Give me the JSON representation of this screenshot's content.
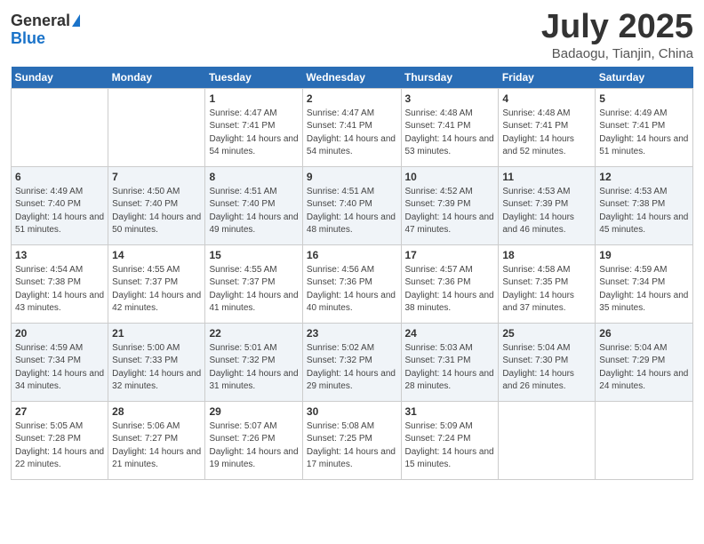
{
  "header": {
    "logo_general": "General",
    "logo_blue": "Blue",
    "month": "July 2025",
    "location": "Badaogu, Tianjin, China"
  },
  "days_of_week": [
    "Sunday",
    "Monday",
    "Tuesday",
    "Wednesday",
    "Thursday",
    "Friday",
    "Saturday"
  ],
  "weeks": [
    [
      {
        "day": "",
        "sunrise": "",
        "sunset": "",
        "daylight": ""
      },
      {
        "day": "",
        "sunrise": "",
        "sunset": "",
        "daylight": ""
      },
      {
        "day": "1",
        "sunrise": "Sunrise: 4:47 AM",
        "sunset": "Sunset: 7:41 PM",
        "daylight": "Daylight: 14 hours and 54 minutes."
      },
      {
        "day": "2",
        "sunrise": "Sunrise: 4:47 AM",
        "sunset": "Sunset: 7:41 PM",
        "daylight": "Daylight: 14 hours and 54 minutes."
      },
      {
        "day": "3",
        "sunrise": "Sunrise: 4:48 AM",
        "sunset": "Sunset: 7:41 PM",
        "daylight": "Daylight: 14 hours and 53 minutes."
      },
      {
        "day": "4",
        "sunrise": "Sunrise: 4:48 AM",
        "sunset": "Sunset: 7:41 PM",
        "daylight": "Daylight: 14 hours and 52 minutes."
      },
      {
        "day": "5",
        "sunrise": "Sunrise: 4:49 AM",
        "sunset": "Sunset: 7:41 PM",
        "daylight": "Daylight: 14 hours and 51 minutes."
      }
    ],
    [
      {
        "day": "6",
        "sunrise": "Sunrise: 4:49 AM",
        "sunset": "Sunset: 7:40 PM",
        "daylight": "Daylight: 14 hours and 51 minutes."
      },
      {
        "day": "7",
        "sunrise": "Sunrise: 4:50 AM",
        "sunset": "Sunset: 7:40 PM",
        "daylight": "Daylight: 14 hours and 50 minutes."
      },
      {
        "day": "8",
        "sunrise": "Sunrise: 4:51 AM",
        "sunset": "Sunset: 7:40 PM",
        "daylight": "Daylight: 14 hours and 49 minutes."
      },
      {
        "day": "9",
        "sunrise": "Sunrise: 4:51 AM",
        "sunset": "Sunset: 7:40 PM",
        "daylight": "Daylight: 14 hours and 48 minutes."
      },
      {
        "day": "10",
        "sunrise": "Sunrise: 4:52 AM",
        "sunset": "Sunset: 7:39 PM",
        "daylight": "Daylight: 14 hours and 47 minutes."
      },
      {
        "day": "11",
        "sunrise": "Sunrise: 4:53 AM",
        "sunset": "Sunset: 7:39 PM",
        "daylight": "Daylight: 14 hours and 46 minutes."
      },
      {
        "day": "12",
        "sunrise": "Sunrise: 4:53 AM",
        "sunset": "Sunset: 7:38 PM",
        "daylight": "Daylight: 14 hours and 45 minutes."
      }
    ],
    [
      {
        "day": "13",
        "sunrise": "Sunrise: 4:54 AM",
        "sunset": "Sunset: 7:38 PM",
        "daylight": "Daylight: 14 hours and 43 minutes."
      },
      {
        "day": "14",
        "sunrise": "Sunrise: 4:55 AM",
        "sunset": "Sunset: 7:37 PM",
        "daylight": "Daylight: 14 hours and 42 minutes."
      },
      {
        "day": "15",
        "sunrise": "Sunrise: 4:55 AM",
        "sunset": "Sunset: 7:37 PM",
        "daylight": "Daylight: 14 hours and 41 minutes."
      },
      {
        "day": "16",
        "sunrise": "Sunrise: 4:56 AM",
        "sunset": "Sunset: 7:36 PM",
        "daylight": "Daylight: 14 hours and 40 minutes."
      },
      {
        "day": "17",
        "sunrise": "Sunrise: 4:57 AM",
        "sunset": "Sunset: 7:36 PM",
        "daylight": "Daylight: 14 hours and 38 minutes."
      },
      {
        "day": "18",
        "sunrise": "Sunrise: 4:58 AM",
        "sunset": "Sunset: 7:35 PM",
        "daylight": "Daylight: 14 hours and 37 minutes."
      },
      {
        "day": "19",
        "sunrise": "Sunrise: 4:59 AM",
        "sunset": "Sunset: 7:34 PM",
        "daylight": "Daylight: 14 hours and 35 minutes."
      }
    ],
    [
      {
        "day": "20",
        "sunrise": "Sunrise: 4:59 AM",
        "sunset": "Sunset: 7:34 PM",
        "daylight": "Daylight: 14 hours and 34 minutes."
      },
      {
        "day": "21",
        "sunrise": "Sunrise: 5:00 AM",
        "sunset": "Sunset: 7:33 PM",
        "daylight": "Daylight: 14 hours and 32 minutes."
      },
      {
        "day": "22",
        "sunrise": "Sunrise: 5:01 AM",
        "sunset": "Sunset: 7:32 PM",
        "daylight": "Daylight: 14 hours and 31 minutes."
      },
      {
        "day": "23",
        "sunrise": "Sunrise: 5:02 AM",
        "sunset": "Sunset: 7:32 PM",
        "daylight": "Daylight: 14 hours and 29 minutes."
      },
      {
        "day": "24",
        "sunrise": "Sunrise: 5:03 AM",
        "sunset": "Sunset: 7:31 PM",
        "daylight": "Daylight: 14 hours and 28 minutes."
      },
      {
        "day": "25",
        "sunrise": "Sunrise: 5:04 AM",
        "sunset": "Sunset: 7:30 PM",
        "daylight": "Daylight: 14 hours and 26 minutes."
      },
      {
        "day": "26",
        "sunrise": "Sunrise: 5:04 AM",
        "sunset": "Sunset: 7:29 PM",
        "daylight": "Daylight: 14 hours and 24 minutes."
      }
    ],
    [
      {
        "day": "27",
        "sunrise": "Sunrise: 5:05 AM",
        "sunset": "Sunset: 7:28 PM",
        "daylight": "Daylight: 14 hours and 22 minutes."
      },
      {
        "day": "28",
        "sunrise": "Sunrise: 5:06 AM",
        "sunset": "Sunset: 7:27 PM",
        "daylight": "Daylight: 14 hours and 21 minutes."
      },
      {
        "day": "29",
        "sunrise": "Sunrise: 5:07 AM",
        "sunset": "Sunset: 7:26 PM",
        "daylight": "Daylight: 14 hours and 19 minutes."
      },
      {
        "day": "30",
        "sunrise": "Sunrise: 5:08 AM",
        "sunset": "Sunset: 7:25 PM",
        "daylight": "Daylight: 14 hours and 17 minutes."
      },
      {
        "day": "31",
        "sunrise": "Sunrise: 5:09 AM",
        "sunset": "Sunset: 7:24 PM",
        "daylight": "Daylight: 14 hours and 15 minutes."
      },
      {
        "day": "",
        "sunrise": "",
        "sunset": "",
        "daylight": ""
      },
      {
        "day": "",
        "sunrise": "",
        "sunset": "",
        "daylight": ""
      }
    ]
  ]
}
